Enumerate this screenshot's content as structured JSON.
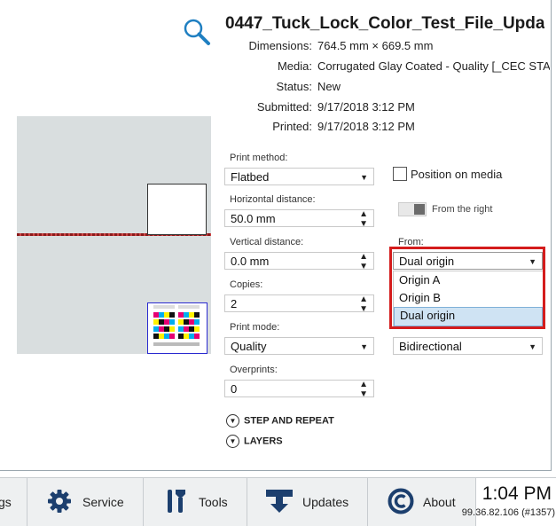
{
  "job": {
    "title": "0447_Tuck_Lock_Color_Test_File_Upda...",
    "meta": [
      {
        "label": "Dimensions:",
        "value": "764.5 mm × 669.5 mm"
      },
      {
        "label": "Media:",
        "value": "Corrugated Glay Coated - Quality [_CEC STA"
      },
      {
        "label": "Status:",
        "value": "New"
      },
      {
        "label": "Submitted:",
        "value": "9/17/2018 3:12 PM"
      },
      {
        "label": "Printed:",
        "value": "9/17/2018 3:12 PM"
      }
    ]
  },
  "form": {
    "print_method": {
      "label": "Print method:",
      "value": "Flatbed"
    },
    "horizontal_distance": {
      "label": "Horizontal distance:",
      "value": "50.0 mm"
    },
    "vertical_distance": {
      "label": "Vertical distance:",
      "value": "0.0 mm"
    },
    "copies": {
      "label": "Copies:",
      "value": "2"
    },
    "print_mode": {
      "label": "Print mode:",
      "value": "Quality"
    },
    "overprints": {
      "label": "Overprints:",
      "value": "0"
    },
    "position_on_media": {
      "label": "Position on media",
      "checked": false
    },
    "from_the_right": {
      "label": "From the right"
    },
    "from": {
      "label": "From:",
      "value": "Dual origin",
      "options": [
        "Origin A",
        "Origin B",
        "Dual origin"
      ],
      "selected_index": 2
    },
    "print_direction": {
      "value": "Bidirectional"
    },
    "step_and_repeat": "STEP AND REPEAT",
    "layers": "LAYERS"
  },
  "taskbar": {
    "partial_label": "gs",
    "service": "Service",
    "tools": "Tools",
    "updates": "Updates",
    "about": "About",
    "time": "1:04 PM",
    "ip": "99.36.82.106 (#1357)"
  },
  "colors": {
    "highlight": "#d41c1c",
    "accent": "#1f7fc1",
    "selected_option": "#cfe3f3"
  },
  "icons": [
    "search-icon",
    "gear-icon",
    "tools-icon",
    "download-icon",
    "copyright-icon",
    "chevron-down-icon"
  ]
}
